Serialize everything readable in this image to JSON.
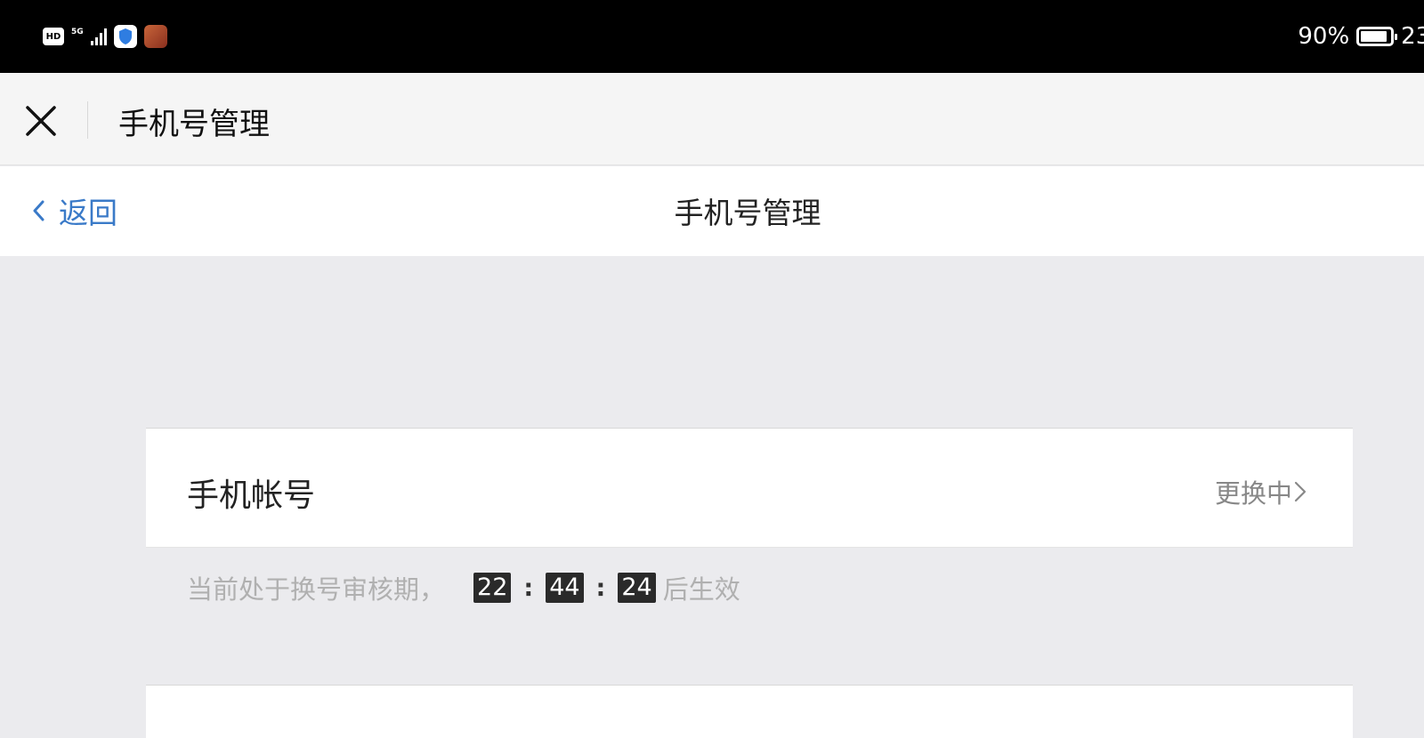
{
  "status_bar": {
    "hd_label": "HD",
    "network_label": "5G",
    "battery_percent": "90%",
    "battery_level": 0.9,
    "clock": "23:"
  },
  "title_bar": {
    "close_icon": "close-icon",
    "title": "手机号管理"
  },
  "page_nav": {
    "back_label": "返回",
    "back_icon": "chevron-left-icon",
    "title": "手机号管理"
  },
  "card": {
    "label": "手机帐号",
    "status": "更换中",
    "status_icon": "chevron-right-icon"
  },
  "notice": {
    "prefix": "当前处于换号审核期，",
    "hours": "22",
    "minutes": "44",
    "seconds": "24",
    "separator": ":",
    "suffix": "后生效"
  },
  "colors": {
    "link": "#3a7ac8",
    "background": "#ebebee",
    "status_bar": "#000000"
  }
}
